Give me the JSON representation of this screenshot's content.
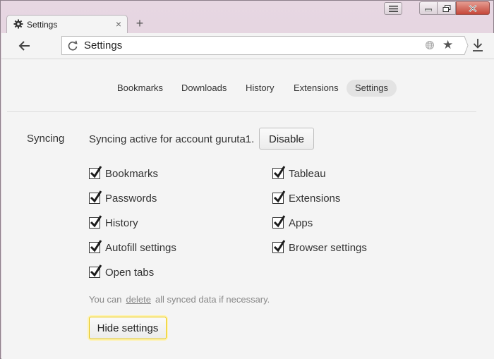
{
  "window": {
    "tab_title": "Settings",
    "tab_close": "×",
    "new_tab": "+"
  },
  "toolbar": {
    "address": "Settings"
  },
  "nav": {
    "items": [
      "Bookmarks",
      "Downloads",
      "History",
      "Extensions",
      "Settings"
    ],
    "active": "Settings"
  },
  "sync": {
    "section_label": "Syncing",
    "status_text": "Syncing active for account guruta1.",
    "disable_label": "Disable",
    "options_left": [
      {
        "label": "Bookmarks",
        "checked": true
      },
      {
        "label": "Passwords",
        "checked": true
      },
      {
        "label": "History",
        "checked": true
      },
      {
        "label": "Autofill settings",
        "checked": true
      },
      {
        "label": "Open tabs",
        "checked": true
      }
    ],
    "options_right": [
      {
        "label": "Tableau",
        "checked": true
      },
      {
        "label": "Extensions",
        "checked": true
      },
      {
        "label": "Apps",
        "checked": true
      },
      {
        "label": "Browser settings",
        "checked": true
      }
    ],
    "note_before": "You can",
    "note_link": "delete",
    "note_after": "all synced data if necessary.",
    "hide_label": "Hide settings"
  },
  "colors": {
    "check": "#1c1c1c",
    "highlight_border": "#e7c400",
    "close_button": "#c5473a"
  }
}
